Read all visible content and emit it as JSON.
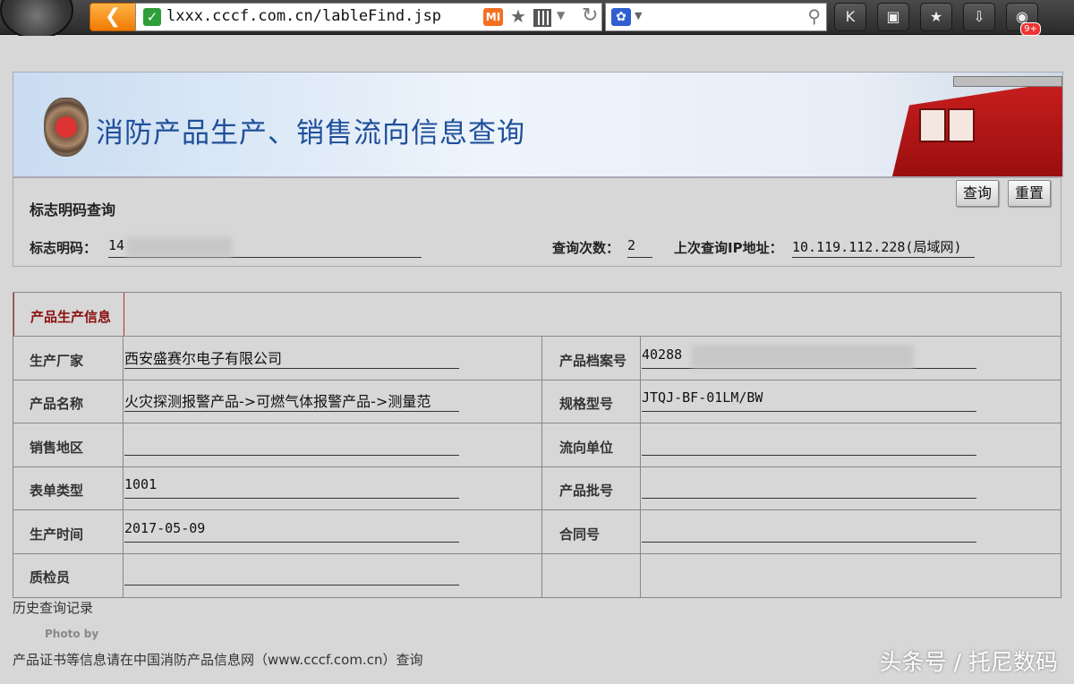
{
  "browser": {
    "url": "lxxx.cccf.com.cn/lableFind.jsp",
    "mi_label": "MI",
    "notification_badge": "9+",
    "icons": [
      "back-icon",
      "secure-check-icon",
      "mi-icon",
      "favorite-star-icon",
      "qr-code-icon",
      "refresh-icon",
      "baidu-paw-icon",
      "search-icon",
      "k-icon",
      "lock-icon",
      "star-icon",
      "download-icon",
      "game-controller-icon"
    ]
  },
  "banner": {
    "title": "消防产品生产、销售流向信息查询"
  },
  "query": {
    "title": "标志明码查询",
    "search_button": "查询",
    "reset_button": "重置",
    "code_label": "标志明码：",
    "code_value": "14",
    "count_label": "查询次数：",
    "count_value": "2",
    "ip_label": "上次查询IP地址：",
    "ip_value": "10.119.112.228(局域网)"
  },
  "production": {
    "section_title": "产品生产信息",
    "rows": [
      {
        "left_label": "生产厂家",
        "left_value": "西安盛赛尔电子有限公司",
        "right_label": "产品档案号",
        "right_value": "40288"
      },
      {
        "left_label": "产品名称",
        "left_value": "火灾探测报警产品->可燃气体报警产品->测量范",
        "right_label": "规格型号",
        "right_value": "JTQJ-BF-01LM/BW"
      },
      {
        "left_label": "销售地区",
        "left_value": "",
        "right_label": "流向单位",
        "right_value": ""
      },
      {
        "left_label": "表单类型",
        "left_value": "1001",
        "right_label": "产品批号",
        "right_value": ""
      },
      {
        "left_label": "生产时间",
        "left_value": "2017-05-09",
        "right_label": "合同号",
        "right_value": ""
      },
      {
        "left_label": "质检员",
        "left_value": "",
        "right_label": "",
        "right_value": ""
      }
    ]
  },
  "history_link": "历史查询记录",
  "photo_by": "Photo by",
  "footer_note": "产品证书等信息请在中国消防产品信息网（www.cccf.com.cn）查询",
  "watermark": "头条号 / 托尼数码",
  "colors": {
    "accent": "#f07a00",
    "banner_title": "#1e4f9a",
    "section_title": "#8a1010"
  }
}
